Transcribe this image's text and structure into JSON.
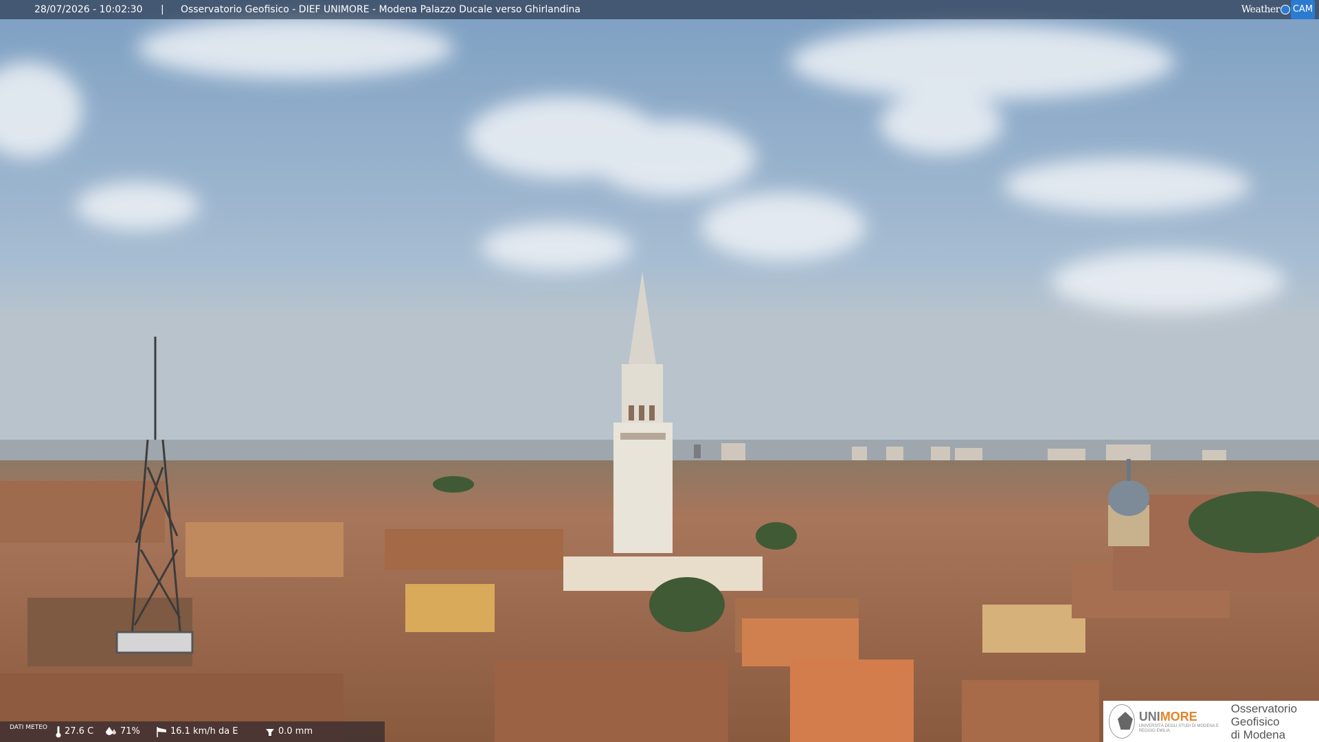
{
  "header": {
    "timestamp": "28/07/2026 - 10:02:30",
    "separator": "|",
    "location": "Osservatorio Geofisico - DIEF UNIMORE - Modena Palazzo Ducale verso Ghirlandina"
  },
  "brand": {
    "weather": "Weather",
    "cam": "CAM",
    "accent": "#2b7bd1"
  },
  "weather_data": {
    "label": "DATI METEO",
    "temperature": "27.6 C",
    "humidity": "71%",
    "wind": "16.1 km/h da E",
    "rain": "0.0 mm",
    "icons": [
      "thermometer-icon",
      "humidity-drop-icon",
      "wind-sock-icon",
      "rain-gauge-icon"
    ]
  },
  "logo": {
    "name_main": "UNI",
    "name_accent": "MORE",
    "subtitle": "UNIVERSITÀ DEGLI STUDI DI MODENA E REGGIO EMILIA",
    "observatory_line1": "Osservatorio Geofisico",
    "observatory_line2": "di Modena"
  },
  "scene": {
    "sky_color": "#8fb0cf",
    "roof_color": "#b5744f",
    "tower_color": "#e2ddd3"
  }
}
